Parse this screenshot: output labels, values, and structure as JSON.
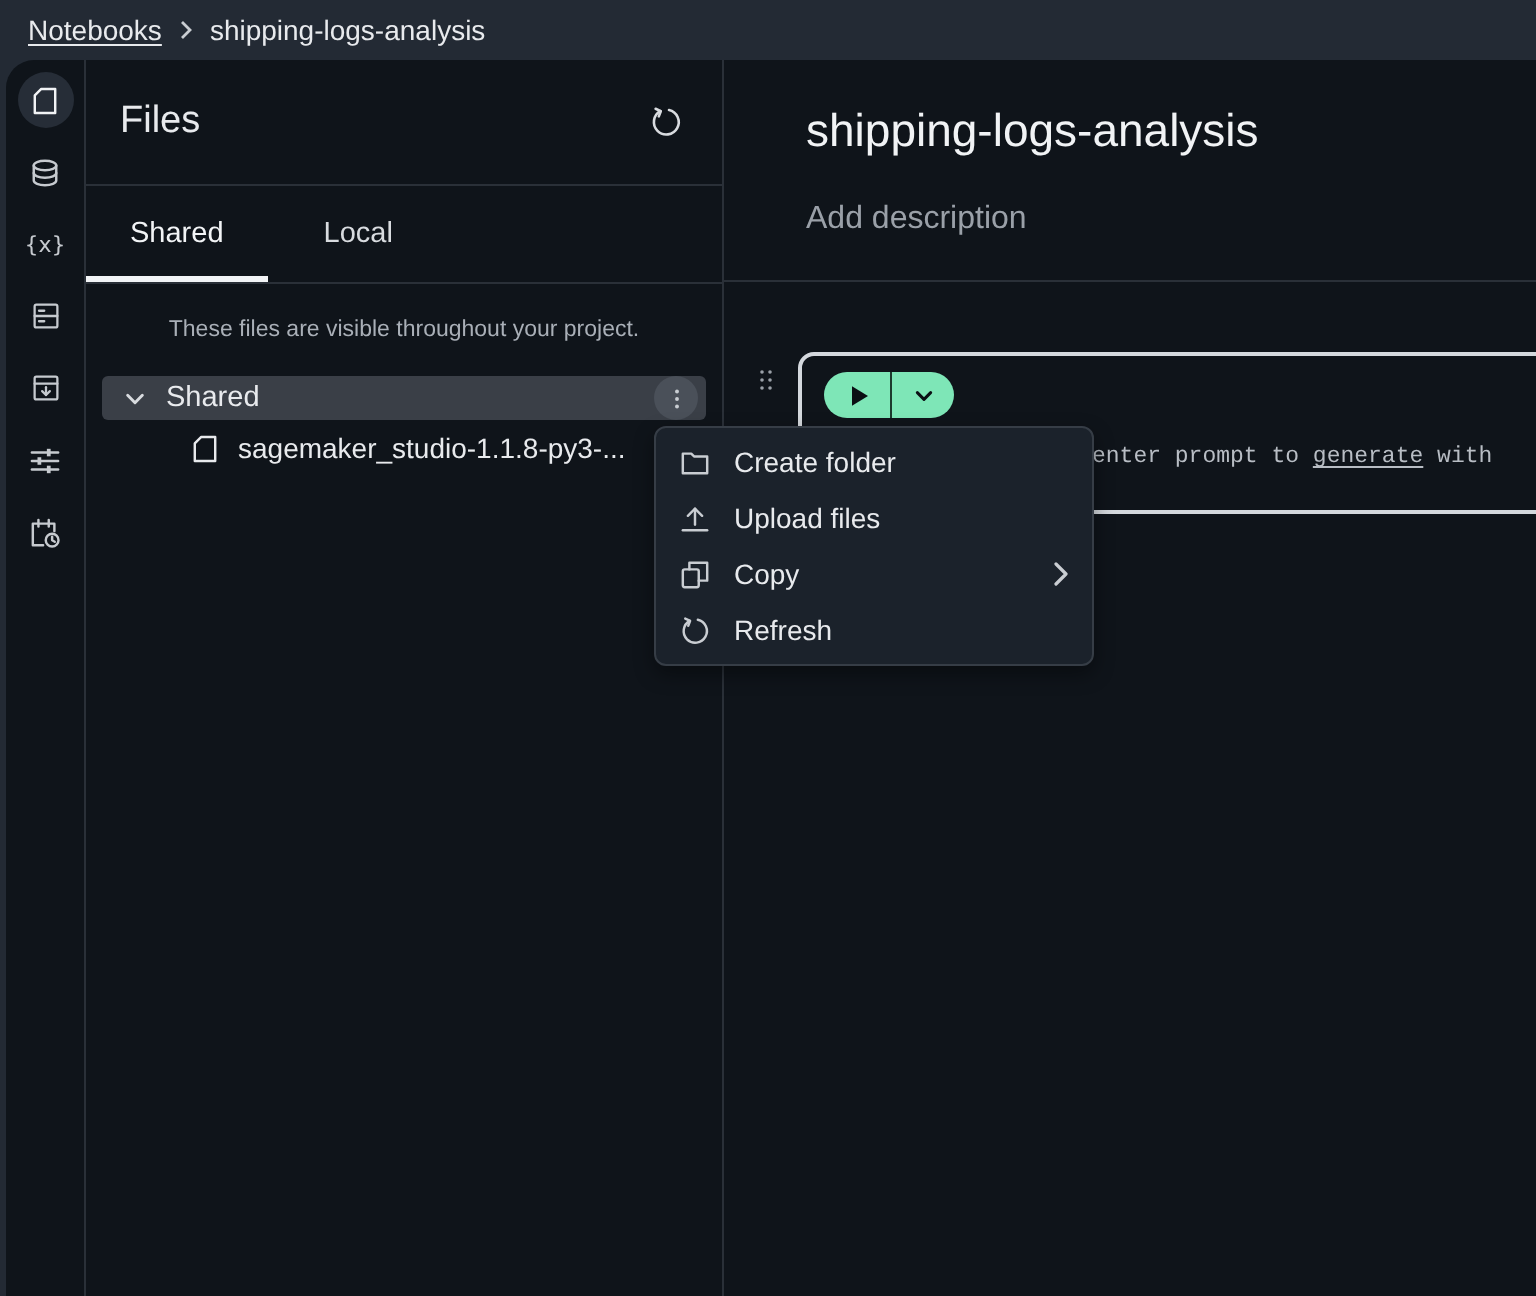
{
  "breadcrumb": [
    {
      "label": "Notebooks",
      "kind": "link"
    },
    {
      "label": "shipping-logs-analysis",
      "kind": "current"
    }
  ],
  "rail": [
    {
      "kind": "file",
      "selected": true
    },
    {
      "kind": "database",
      "selected": false
    },
    {
      "kind": "variables",
      "label": "{x}",
      "selected": false
    },
    {
      "kind": "server",
      "selected": false
    },
    {
      "kind": "box-download",
      "selected": false
    },
    {
      "kind": "sliders",
      "selected": false
    },
    {
      "kind": "calendar-clock",
      "selected": false
    }
  ],
  "files_panel": {
    "title": "Files",
    "tabs": [
      {
        "label": "Shared",
        "selected": true
      },
      {
        "label": "Local",
        "selected": false
      }
    ],
    "note": "These files are visible throughout your project.",
    "tree": [
      {
        "label": "Shared",
        "kind": "folder",
        "expanded": true,
        "selected": true,
        "children": [
          {
            "label": "sagemaker_studio-1.1.8-py3-...",
            "kind": "file",
            "selected": false
          }
        ]
      }
    ]
  },
  "notebook": {
    "title": "shipping-logs-analysis",
    "description": {
      "placeholder": "Add description"
    },
    "cell": {
      "prompt": {
        "before": "enter prompt to",
        "link": "generate",
        "after": "with"
      }
    }
  },
  "context_menu": {
    "items": [
      {
        "label": "Create folder",
        "kind": "folder",
        "submenu": false
      },
      {
        "label": "Upload files",
        "kind": "upload",
        "submenu": false
      },
      {
        "label": "Copy",
        "kind": "copy",
        "submenu": true
      },
      {
        "label": "Refresh",
        "kind": "refresh",
        "submenu": false
      }
    ]
  }
}
